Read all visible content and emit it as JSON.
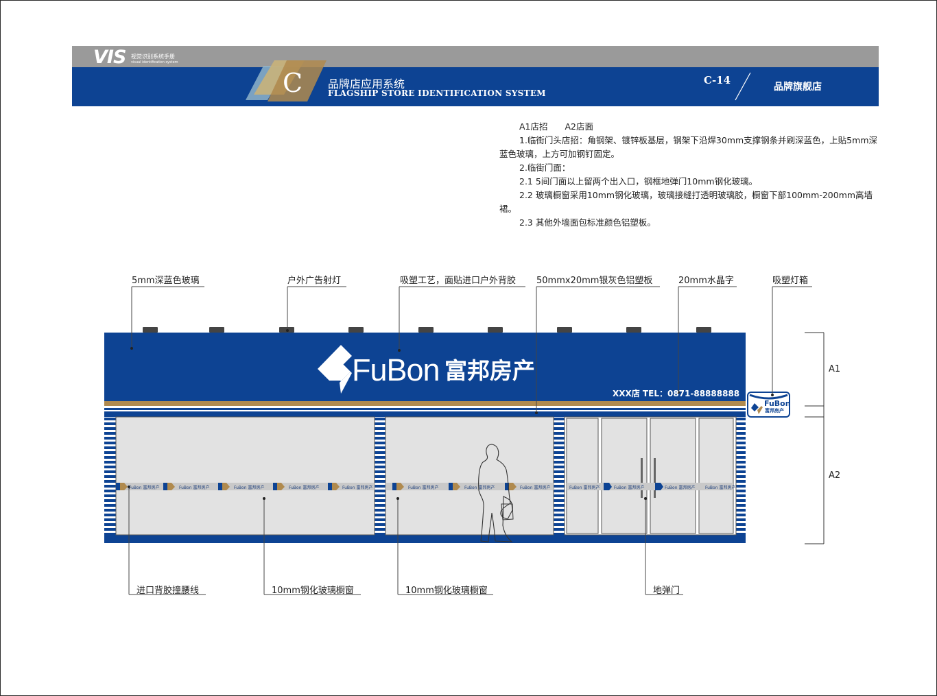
{
  "header": {
    "logo": "VIS",
    "logo_cn": "视觉识别系统手册",
    "logo_en": "visual identification system",
    "badge_letter": "C",
    "section_cn": "品牌店应用系统",
    "section_en": "FLAGSHIP STORE IDENTIFICATION SYSTEM",
    "page_code": "C-14",
    "page_title": "品牌旗舰店"
  },
  "description": {
    "line1": "A1店招　　A2店面",
    "line2": "1.临街门头店招：角钢架、镀锌板基层，钢架下沿焊30mm支撑钢条并刷深蓝色，上贴5mm深蓝色玻璃，上方可加钢钉固定。",
    "line3": "2.临街门面：",
    "line4": "2.1  5间门面以上留两个出入口，钢框地弹门10mm钢化玻璃。",
    "line5": "2.2  玻璃橱窗采用10mm钢化玻璃，玻璃接缝打透明玻璃胶，橱窗下部100mm-200mm高墙裙。",
    "line6": "2.3  其他外墙面包标准颜色铝塑板。"
  },
  "callouts_top": {
    "glass": "5mm深蓝色玻璃",
    "spotlight": "户外广告射灯",
    "vacuum": "吸塑工艺，面贴进口户外背胶",
    "alu_panel": "50mmx20mm银灰色铝塑板",
    "crystal": "20mm水晶字",
    "lightbox": "吸塑灯箱"
  },
  "callouts_bottom": {
    "waistline": "进口背胶撞腰线",
    "window1": "10mm钢化玻璃橱窗",
    "window2": "10mm钢化玻璃橱窗",
    "door": "地弹门"
  },
  "sign": {
    "brand": "FuBon",
    "brand_cn": "富邦房产",
    "shop_tel": "XXX店 TEL：0871-88888888"
  },
  "lightbox": {
    "brand": "FuBon",
    "brand_cn": "富邦房产"
  },
  "strip": {
    "brand": "FuBon",
    "brand_cn": "富邦房产"
  },
  "dimensions": {
    "a1": "A1",
    "a2": "A2"
  },
  "colors": {
    "brand_blue": "#0d4393",
    "header_grey": "#9a9a9a",
    "gold": "#b08a4e",
    "glass_grey": "#e2e2e2"
  }
}
